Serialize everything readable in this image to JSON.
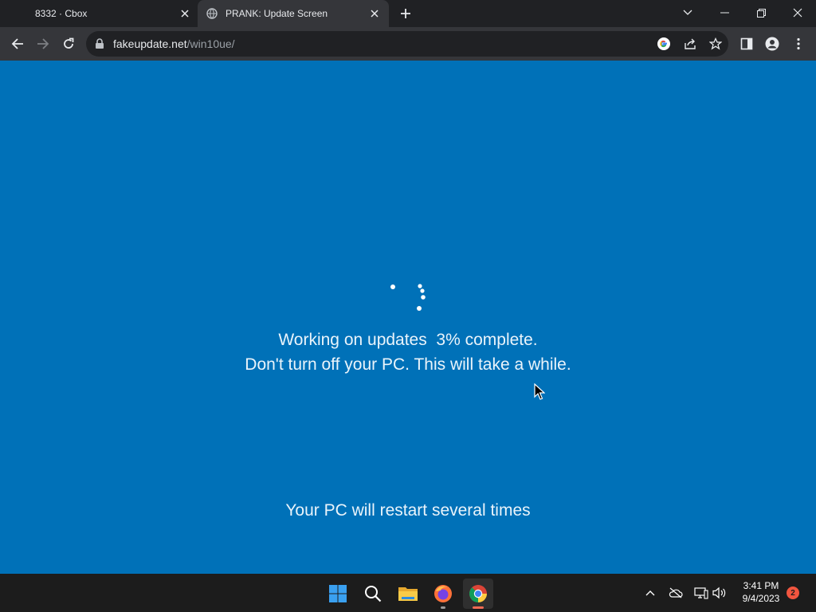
{
  "browser": {
    "tabs": [
      {
        "title": "8332 · Cbox",
        "active": false,
        "favicon": "none"
      },
      {
        "title": "PRANK: Update Screen",
        "active": true,
        "favicon": "globe-icon"
      }
    ],
    "new_tab_icon": "plus-icon",
    "window_controls": [
      "tab-search-icon",
      "minimize-icon",
      "restore-icon",
      "close-icon"
    ],
    "toolbar": {
      "back_icon": "arrow-left-icon",
      "forward_icon": "arrow-right-icon",
      "reload_icon": "reload-icon",
      "url_host": "fakeupdate.net",
      "url_path": "/win10ue/",
      "omnibox_icons": [
        "google-lens-icon",
        "share-icon",
        "star-icon"
      ],
      "right_icons": [
        "side-panel-icon",
        "profile-icon",
        "menu-dots-icon"
      ]
    }
  },
  "page": {
    "background_color": "#0071b8",
    "progress_percent": 3,
    "status_line1": "Working on updates  3% complete.",
    "status_line2": "Don't turn off your PC. This will take a while.",
    "restart_notice": "Your PC will restart several times"
  },
  "taskbar": {
    "apps": [
      "windows-start-icon",
      "search-icon",
      "file-explorer-icon",
      "firefox-icon",
      "chrome-icon"
    ],
    "active_app": "chrome-icon",
    "tray_icons": [
      "chevron-up-icon",
      "onedrive-offline-icon",
      "network-icon",
      "speaker-icon"
    ],
    "time": "3:41 PM",
    "date": "9/4/2023",
    "notification_count": "2"
  }
}
